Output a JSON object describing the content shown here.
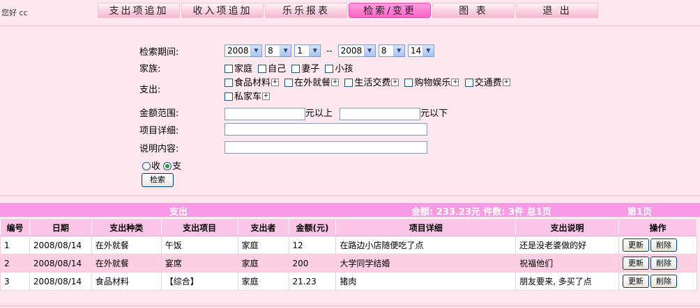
{
  "header": {
    "greeting": "您好 cc",
    "nav": [
      "支出项追加",
      "收入项追加",
      "乐乐报表",
      "检索/变更",
      "图  表",
      "退  出"
    ]
  },
  "search": {
    "period_label": "检索期间:",
    "from": {
      "year": "2008",
      "month": "8",
      "day": "1"
    },
    "range_sep": "--",
    "to": {
      "year": "2008",
      "month": "8",
      "day": "14"
    },
    "family_label": "家族:",
    "family_options": [
      "家庭",
      "自己",
      "妻子",
      "小孩"
    ],
    "expense_label": "支出:",
    "expense_options": [
      "食品材料",
      "在外就餐",
      "生活交费",
      "购物娱乐",
      "交通费",
      "私家车"
    ],
    "amount_label": "金额范围:",
    "amount_above": "元以上",
    "amount_below": "元以下",
    "detail_label": "项目详细:",
    "desc_label": "说明内容:",
    "radio_income": "收",
    "radio_expense": "支",
    "search_button": "检索"
  },
  "results": {
    "title": "支出",
    "summary": "金额: 233.23元  件数: 3件  总1页",
    "page": "第1页",
    "columns": [
      "编号",
      "日期",
      "支出种类",
      "支出项目",
      "支出者",
      "金额(元)",
      "项目详细",
      "支出说明",
      "操作"
    ],
    "update_label": "更新",
    "delete_label": "削除",
    "rows": [
      {
        "no": "1",
        "date": "2008/08/14",
        "type": "在外就餐",
        "item": "午饭",
        "who": "家庭",
        "amount": "12",
        "detail": "在路边小店随便吃了点",
        "note": "还是没老婆做的好"
      },
      {
        "no": "2",
        "date": "2008/08/14",
        "type": "在外就餐",
        "item": "宴席",
        "who": "家庭",
        "amount": "200",
        "detail": "大学同学结婚",
        "note": "祝福他们"
      },
      {
        "no": "3",
        "date": "2008/08/14",
        "type": "食品材料",
        "item": "【综合】",
        "who": "家庭",
        "amount": "21.23",
        "detail": "猪肉",
        "note": "朋友要来, 多买了点"
      }
    ]
  }
}
